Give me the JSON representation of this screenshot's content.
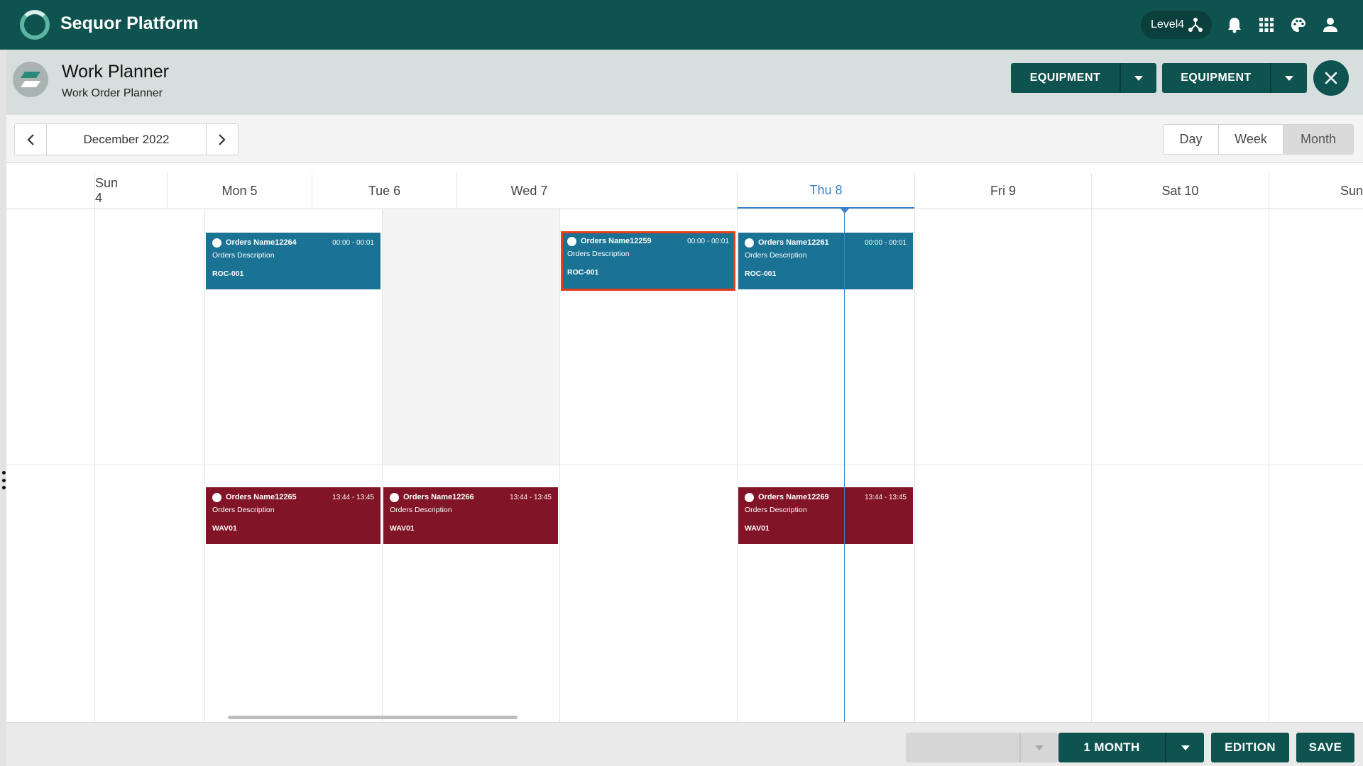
{
  "app": {
    "title": "Sequor Platform",
    "level": "Level4"
  },
  "page": {
    "title": "Work Planner",
    "subtitle": "Work Order Planner"
  },
  "header_buttons": [
    {
      "label": "EQUIPMENT"
    },
    {
      "label": "EQUIPMENT"
    }
  ],
  "toolbar": {
    "date_label": "December 2022",
    "views": [
      "Day",
      "Week",
      "Month"
    ],
    "active_view": "Month"
  },
  "calendar": {
    "days": [
      "Sun 4",
      "Mon 5",
      "Tue 6",
      "Wed 7",
      "Thu 8",
      "Fri 9",
      "Sat 10",
      "Sun"
    ],
    "today": "Thu 8",
    "events": [
      {
        "name": "Orders Name12264",
        "time": "00:00 - 00:01",
        "description": "Orders Description",
        "code": "ROC-001",
        "color": "#1a7294"
      },
      {
        "name": "Orders Name12259",
        "time": "00:00 - 00:01",
        "description": "Orders Description",
        "code": "ROC-001",
        "color": "#1a7294",
        "selected": true
      },
      {
        "name": "Orders Name12261",
        "time": "00:00 - 00:01",
        "description": "Orders Description",
        "code": "ROC-001",
        "color": "#1a7294"
      },
      {
        "name": "Orders Name12265",
        "time": "13:44 - 13:45",
        "description": "Orders Description",
        "code": "WAV01",
        "color": "#811426"
      },
      {
        "name": "Orders Name12266",
        "time": "13:44 - 13:45",
        "description": "Orders Description",
        "code": "WAV01",
        "color": "#811426"
      },
      {
        "name": "Orders Name12269",
        "time": "13:44 - 13:45",
        "description": "Orders Description",
        "code": "WAV01",
        "color": "#811426"
      }
    ]
  },
  "footer": {
    "range_label": "1 MONTH",
    "edition_label": "EDITION",
    "save_label": "SAVE"
  },
  "colors": {
    "primary": "#0f5350",
    "event_blue": "#1a7294",
    "event_red": "#811426",
    "today": "#3a7fcb",
    "selected_border": "#e83d1e"
  }
}
